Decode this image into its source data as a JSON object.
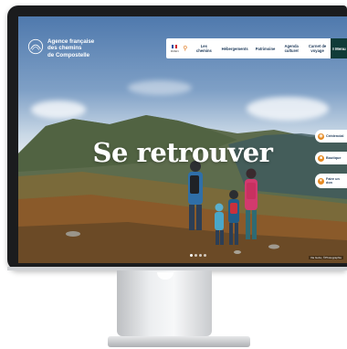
{
  "site": {
    "logo_lines": [
      "Agence française",
      "des chemins",
      "de Compostelle"
    ]
  },
  "nav": {
    "lang_label": "FR/EN",
    "items": [
      {
        "label": "Les chemins"
      },
      {
        "label": "Hébergements"
      },
      {
        "label": "Patrimoine"
      },
      {
        "label": "Agenda culturel"
      },
      {
        "label": "Carnet de voyage"
      }
    ],
    "menu_label": "Menu"
  },
  "hero": {
    "title": "Se retrouver",
    "credit": "Via Gebo, ©Photographie",
    "slides": 4,
    "active_slide": 1
  },
  "side_actions": [
    {
      "label": "Crédencial",
      "icon": "credential-icon"
    },
    {
      "label": "Boutique",
      "icon": "shop-icon"
    },
    {
      "label": "Faire un don",
      "icon": "donate-icon"
    }
  ],
  "colors": {
    "nav_dark": "#0f3b38",
    "accent": "#e58a23",
    "nav_text": "#1e3a5a"
  }
}
